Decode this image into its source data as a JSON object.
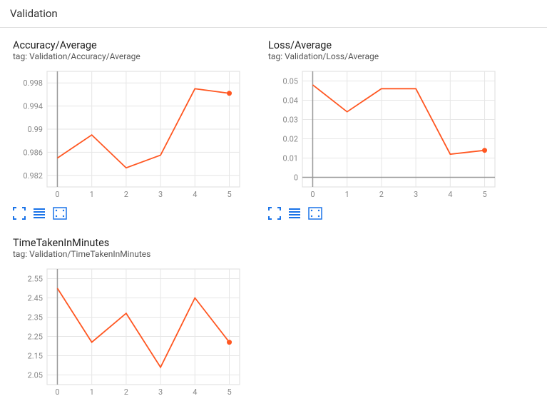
{
  "section": {
    "title": "Validation"
  },
  "charts": [
    {
      "title": "Accuracy/Average",
      "tag": "tag: Validation/Accuracy/Average"
    },
    {
      "title": "Loss/Average",
      "tag": "tag: Validation/Loss/Average"
    },
    {
      "title": "TimeTakenInMinutes",
      "tag": "tag: Validation/TimeTakenInMinutes"
    }
  ],
  "chart_data": [
    {
      "type": "line",
      "title": "Accuracy/Average",
      "xlabel": "",
      "ylabel": "",
      "x": [
        0,
        1,
        2,
        3,
        4,
        5
      ],
      "values": [
        0.985,
        0.989,
        0.9833,
        0.9855,
        0.997,
        0.9962
      ],
      "xlim": [
        -0.3,
        5.3
      ],
      "ylim": [
        0.98,
        1.0
      ],
      "yticks": [
        0.982,
        0.986,
        0.99,
        0.994,
        0.998
      ],
      "xticks": [
        0,
        1,
        2,
        3,
        4,
        5
      ],
      "highlight_last": true
    },
    {
      "type": "line",
      "title": "Loss/Average",
      "xlabel": "",
      "ylabel": "",
      "x": [
        0,
        1,
        2,
        3,
        4,
        5
      ],
      "values": [
        0.048,
        0.034,
        0.046,
        0.046,
        0.012,
        0.014
      ],
      "xlim": [
        -0.3,
        5.3
      ],
      "ylim": [
        -0.005,
        0.055
      ],
      "yticks": [
        0,
        0.01,
        0.02,
        0.03,
        0.04,
        0.05
      ],
      "xticks": [
        0,
        1,
        2,
        3,
        4,
        5
      ],
      "highlight_last": true
    },
    {
      "type": "line",
      "title": "TimeTakenInMinutes",
      "xlabel": "",
      "ylabel": "",
      "x": [
        0,
        1,
        2,
        3,
        4,
        5
      ],
      "values": [
        2.5,
        2.22,
        2.37,
        2.09,
        2.45,
        2.22
      ],
      "xlim": [
        -0.3,
        5.3
      ],
      "ylim": [
        2.0,
        2.6
      ],
      "yticks": [
        2.05,
        2.15,
        2.25,
        2.35,
        2.45,
        2.55
      ],
      "xticks": [
        0,
        1,
        2,
        3,
        4,
        5
      ],
      "highlight_last": true
    }
  ]
}
